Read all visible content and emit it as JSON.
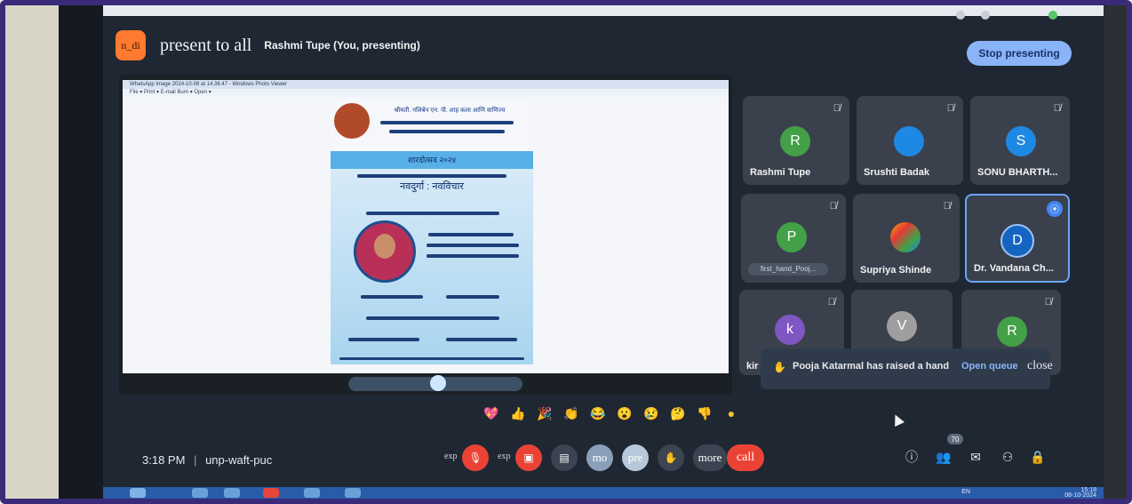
{
  "topbar": {
    "badge": "n_di",
    "present_title": "present to all",
    "presenter": "Rashmi Tupe (You, presenting)",
    "stop_label": "Stop presenting"
  },
  "shared_screen": {
    "window_title": "WhatsApp Image 2024-10-08 at 14.38.47 - Windows Photo Viewer",
    "menu": "File  ▾  Print  ▾  E-mail   Burn  ▾   Open  ▾",
    "poster_lines": [
      "श्रीमती. नलिबेन एन. पी. शाह कला आणि वाणिज्य",
      "शारदोत्सव २०२४",
      "नवदुर्गा : नवविचार"
    ]
  },
  "participants": [
    {
      "name": "Rashmi Tupe",
      "initial": "R",
      "color": "#43a047",
      "muted": true
    },
    {
      "name": "Srushti Badak",
      "initial": "",
      "color": "#1e88e5",
      "muted": true
    },
    {
      "name": "SONU BHARTH...",
      "initial": "S",
      "color": "#1e88e5",
      "muted": true
    },
    {
      "name": "first_hand_Pooj...",
      "initial": "P",
      "color": "#43a047",
      "muted": true
    },
    {
      "name": "Supriya Shinde",
      "initial": "",
      "color": "#f4b400",
      "muted": true
    },
    {
      "name": "Dr. Vandana Ch...",
      "initial": "D",
      "color": "#1565c0",
      "muted": false
    },
    {
      "name": "kir",
      "initial": "k",
      "color": "#7e57c2",
      "muted": true
    },
    {
      "name": "",
      "initial": "V",
      "color": "#9e9e9e",
      "muted": false
    },
    {
      "name": "",
      "initial": "R",
      "color": "#43a047",
      "muted": true
    }
  ],
  "toast": {
    "message": "Pooja Katarmal has raised a hand",
    "action": "Open queue",
    "close": "close"
  },
  "reactions": [
    "💖",
    "👍",
    "🎉",
    "👏",
    "😂",
    "😮",
    "😢",
    "🤔",
    "👎",
    "●"
  ],
  "bottom": {
    "time": "3:18 PM",
    "separator": "|",
    "meeting_code": "unp-waft-puc",
    "controls": [
      {
        "label": "exp",
        "icon": "mic-off-icon"
      },
      {
        "label": "exp",
        "icon": "camera-off-icon"
      },
      {
        "label": "",
        "icon": "captions-icon"
      },
      {
        "label": "mo",
        "icon": "emoji-icon"
      },
      {
        "label": "pre",
        "icon": "present-icon"
      },
      {
        "label": "",
        "icon": "raise-hand-icon"
      },
      {
        "label": "more",
        "icon": "more-options-icon"
      }
    ],
    "end_label": "call",
    "people_count": "70"
  },
  "taskbar": {
    "lang": "EN",
    "clock_time": "15:18",
    "clock_date": "08-10-2024"
  }
}
